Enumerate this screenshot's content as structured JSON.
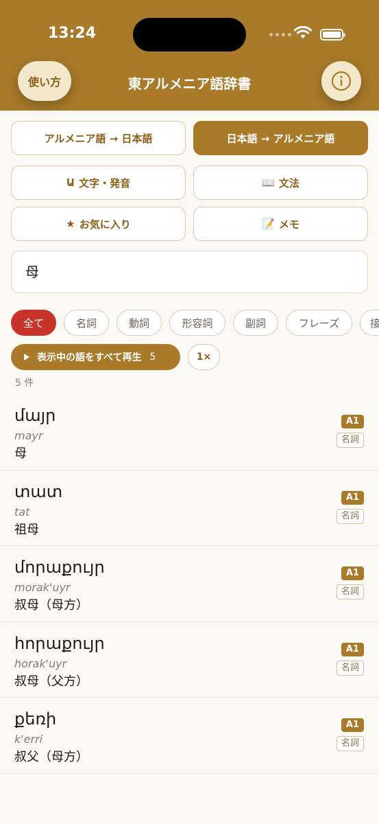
{
  "status": {
    "time": "13:24"
  },
  "header": {
    "title": "東アルメニア語辞書",
    "howto_label": "使い方"
  },
  "direction": {
    "arm_to_jp": "アルメニア語 → 日本語",
    "jp_to_arm": "日本語 → アルメニア語",
    "active": "jp_to_arm"
  },
  "menu": {
    "letters": {
      "icon": "Ա",
      "label": "文字・発音"
    },
    "grammar": {
      "icon": "📖",
      "label": "文法"
    },
    "favorites": {
      "icon": "★",
      "label": "お気に入り"
    },
    "memo": {
      "icon": "📝",
      "label": "メモ"
    }
  },
  "search": {
    "value": "母"
  },
  "filters": [
    "全て",
    "名詞",
    "動詞",
    "形容詞",
    "副詞",
    "フレーズ",
    "接"
  ],
  "playall": {
    "label": "表示中の語をすべて再生",
    "count": "5",
    "speed": "1×"
  },
  "result_count": "5 件",
  "entries": [
    {
      "word": "մայր",
      "translit": "mayr",
      "meaning": "母",
      "level": "A1",
      "pos": "名詞"
    },
    {
      "word": "տատ",
      "translit": "tat",
      "meaning": "祖母",
      "level": "A1",
      "pos": "名詞"
    },
    {
      "word": "մորաքույր",
      "translit": "morak'uyr",
      "meaning": "叔母（母方）",
      "level": "A1",
      "pos": "名詞"
    },
    {
      "word": "հորաքույր",
      "translit": "horak'uyr",
      "meaning": "叔母（父方）",
      "level": "A1",
      "pos": "名詞"
    },
    {
      "word": "քեռի",
      "translit": "k'erri",
      "meaning": "叔父（母方）",
      "level": "A1",
      "pos": "名詞"
    }
  ],
  "colors": {
    "brand": "#a87a2a",
    "active_filter": "#c8342b",
    "background": "#fbf9f4"
  }
}
